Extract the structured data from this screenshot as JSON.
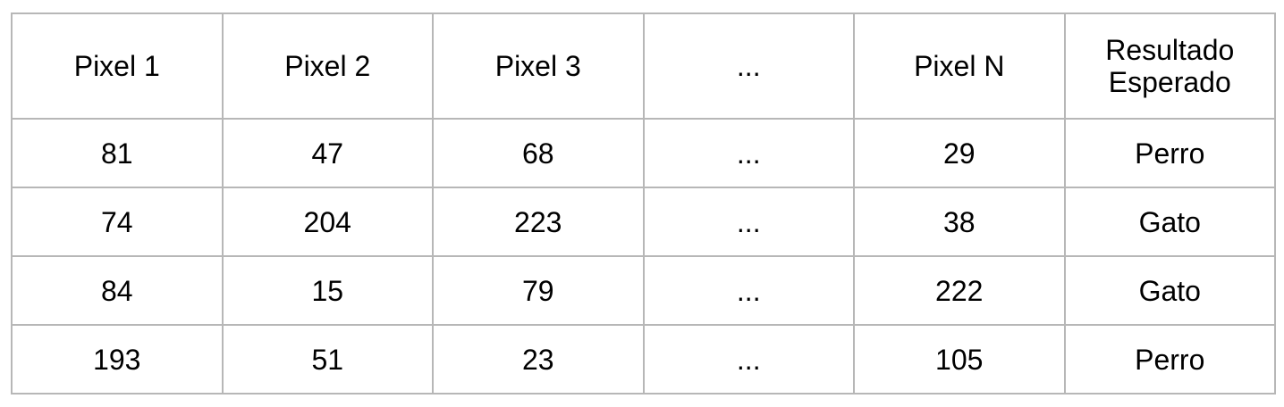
{
  "table": {
    "headers": [
      "Pixel 1",
      "Pixel 2",
      "Pixel 3",
      "...",
      "Pixel N",
      "Resultado Esperado"
    ],
    "rows": [
      [
        "81",
        "47",
        "68",
        "...",
        "29",
        "Perro"
      ],
      [
        "74",
        "204",
        "223",
        "...",
        "38",
        "Gato"
      ],
      [
        "84",
        "15",
        "79",
        "...",
        "222",
        "Gato"
      ],
      [
        "193",
        "51",
        "23",
        "...",
        "105",
        "Perro"
      ]
    ]
  }
}
